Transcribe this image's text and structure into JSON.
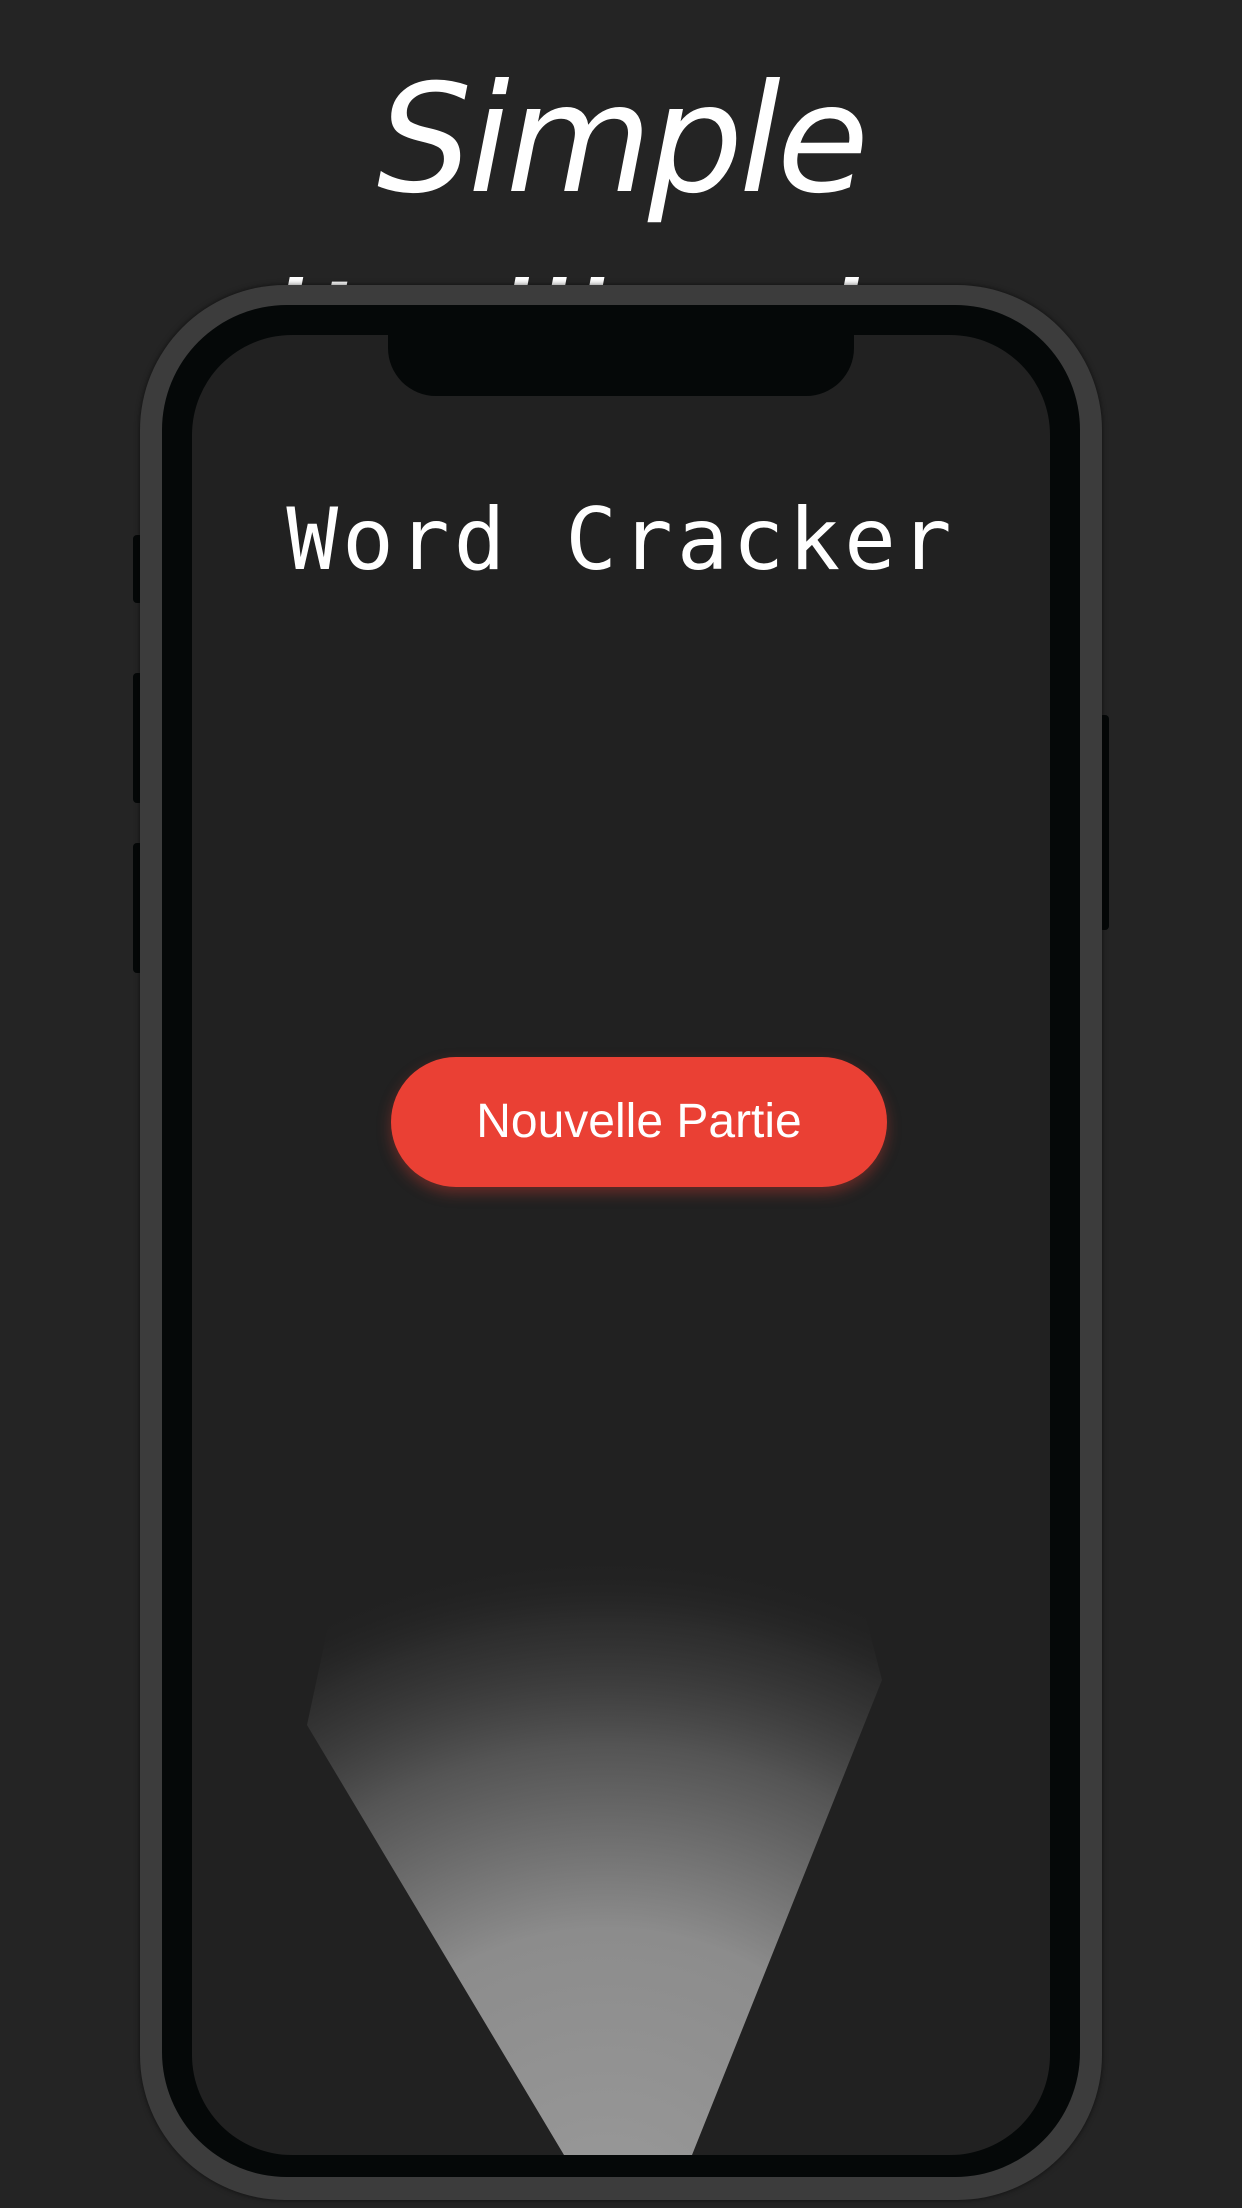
{
  "headline": "Simple d’utilisation",
  "app": {
    "title": "Word Cracker",
    "new_game_label": "Nouvelle Partie"
  },
  "colors": {
    "background": "#242424",
    "screen": "#212121",
    "accent": "#ea4034",
    "bezel": "#050808"
  },
  "icons": [
    "flashlight-beam-icon"
  ]
}
